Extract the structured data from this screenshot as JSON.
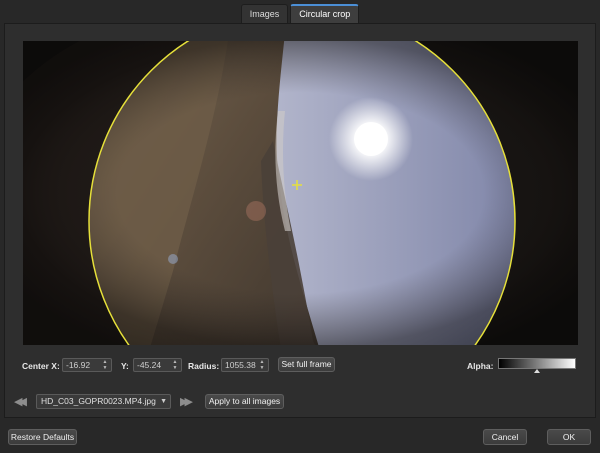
{
  "tabs": [
    {
      "label": "Images",
      "active": false
    },
    {
      "label": "Circular crop",
      "active": true
    }
  ],
  "crop": {
    "center_x_label": "Center X:",
    "center_x_value": "-16.92",
    "y_label": "Y:",
    "y_value": "-45.24",
    "radius_label": "Radius:",
    "radius_value": "1055.38",
    "set_full_frame_label": "Set full frame",
    "alpha_label": "Alpha:",
    "alpha_level": 0.5,
    "circle_color": "#e6e03a"
  },
  "image_nav": {
    "current_image": "HD_C03_GOPR0023.MP4.jpg",
    "apply_all_label": "Apply to all images",
    "prev_icon": "rewind-icon",
    "next_icon": "fast-forward-icon"
  },
  "footer": {
    "restore_label": "Restore Defaults",
    "cancel_label": "Cancel",
    "ok_label": "OK"
  },
  "colors": {
    "background": "#282828",
    "accent": "#4b8fd6"
  }
}
